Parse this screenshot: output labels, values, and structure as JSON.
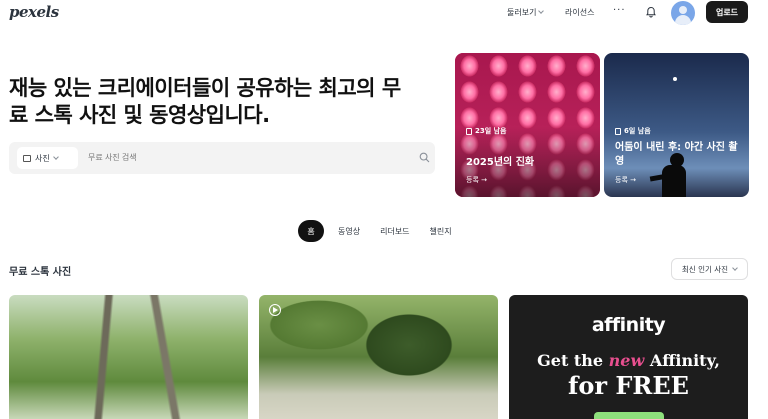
{
  "header": {
    "logo": "pexels",
    "nav": [
      {
        "label": "둘러보기",
        "has_dropdown": true
      },
      {
        "label": "라이선스",
        "has_dropdown": false
      }
    ],
    "more": "···",
    "upload_label": "업로드"
  },
  "hero": {
    "title_line1": "재능 있는 크리에이터들이 공유하는 최고의 무",
    "title_line2": "료 스톡 사진 및 동영상입니다.",
    "search": {
      "type_label": "사진",
      "placeholder": "무료 사진 검색"
    }
  },
  "challenges": [
    {
      "remaining": "23일 남음",
      "title": "2025년의 진화",
      "cta": "등록 →"
    },
    {
      "remaining": "6일 남음",
      "title": "어둠이 내린 후: 야간 사진 촬영",
      "cta": "등록 →"
    }
  ],
  "tabs": [
    {
      "label": "홈",
      "active": true
    },
    {
      "label": "동영상",
      "active": false
    },
    {
      "label": "리더보드",
      "active": false
    },
    {
      "label": "챌린지",
      "active": false
    }
  ],
  "feed": {
    "title": "무료 스톡 사진",
    "sort_label": "최신 인기 사진"
  },
  "ad": {
    "brand": "affinity",
    "headline_pre": "Get the ",
    "headline_em": "new",
    "headline_post": " Affinity,",
    "headline2": "for FREE"
  },
  "colors": {
    "accent_dark": "#1a1a1a",
    "ad_pink": "#e84f8f",
    "ad_green": "#8ee07c"
  }
}
